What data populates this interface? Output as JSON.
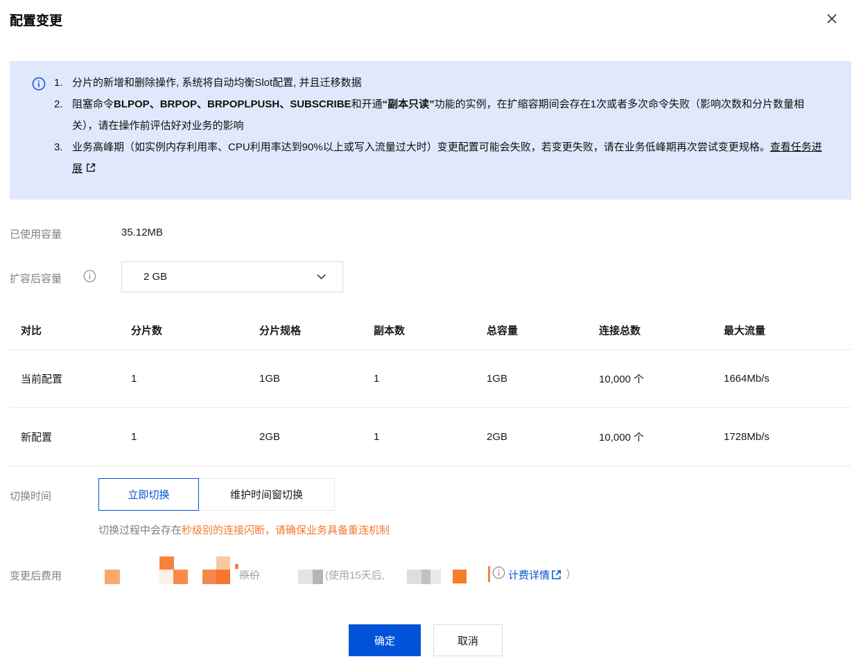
{
  "dialog": {
    "title": "配置变更"
  },
  "notice": {
    "item1": {
      "num": "1.",
      "text": "分片的新增和删除操作, 系统将自动均衡Slot配置, 并且迁移数据"
    },
    "item2": {
      "num": "2.",
      "seg1": "阻塞命令",
      "seg2_bold": "BLPOP、BRPOP、BRPOPLPUSH、SUBSCRIBE",
      "seg3": "和开通",
      "seg4_bold": "“副本只读”",
      "seg5": "功能的实例，在扩缩容期间会存在1次或者多次命令失败（影响次数和分片数量相关），请在操作前评估好对业务的影响"
    },
    "item3": {
      "num": "3.",
      "seg1": "业务高峰期（如实例内存利用率、CPU利用率达到90%以上或写入流量过大时）变更配置可能会失败，若变更失败，请在业务低峰期再次尝试变更规格。",
      "link": "查看任务进展"
    }
  },
  "form": {
    "used_capacity_label": "已使用容量",
    "used_capacity_value": "35.12MB",
    "expand_capacity_label": "扩容后容量",
    "capacity_select_value": "2 GB"
  },
  "table": {
    "headers": [
      "对比",
      "分片数",
      "分片规格",
      "副本数",
      "总容量",
      "连接总数",
      "最大流量"
    ],
    "rows": [
      {
        "name": "当前配置",
        "shards": "1",
        "shard_spec": "1GB",
        "replicas": "1",
        "total_capacity": "1GB",
        "max_connections": "10,000 个",
        "max_bandwidth": "1664Mb/s"
      },
      {
        "name": "新配置",
        "shards": "1",
        "shard_spec": "2GB",
        "replicas": "1",
        "total_capacity": "2GB",
        "max_connections": "10,000 个",
        "max_bandwidth": "1728Mb/s"
      }
    ]
  },
  "switch_time": {
    "label": "切换时间",
    "tab_immediate": "立即切换",
    "tab_maintenance": "维护时间窗切换",
    "warning_prefix": "切换过程中会存在",
    "warning_highlight": "秒级别的连接闪断，请确保业务具备重连机制"
  },
  "fee": {
    "label": "变更后费用",
    "original_price_label": "原价",
    "after_days_text": "(使用15天后,",
    "billing_detail_link": "计费详情",
    "closing_paren": ")"
  },
  "footer": {
    "confirm_label": "确定",
    "cancel_label": "取消"
  },
  "colors": {
    "accent_blue": "#0052d9",
    "banner_bg": "#e0e8fc",
    "warning_orange": "#f5782c",
    "link_blue": "#0052d9"
  }
}
